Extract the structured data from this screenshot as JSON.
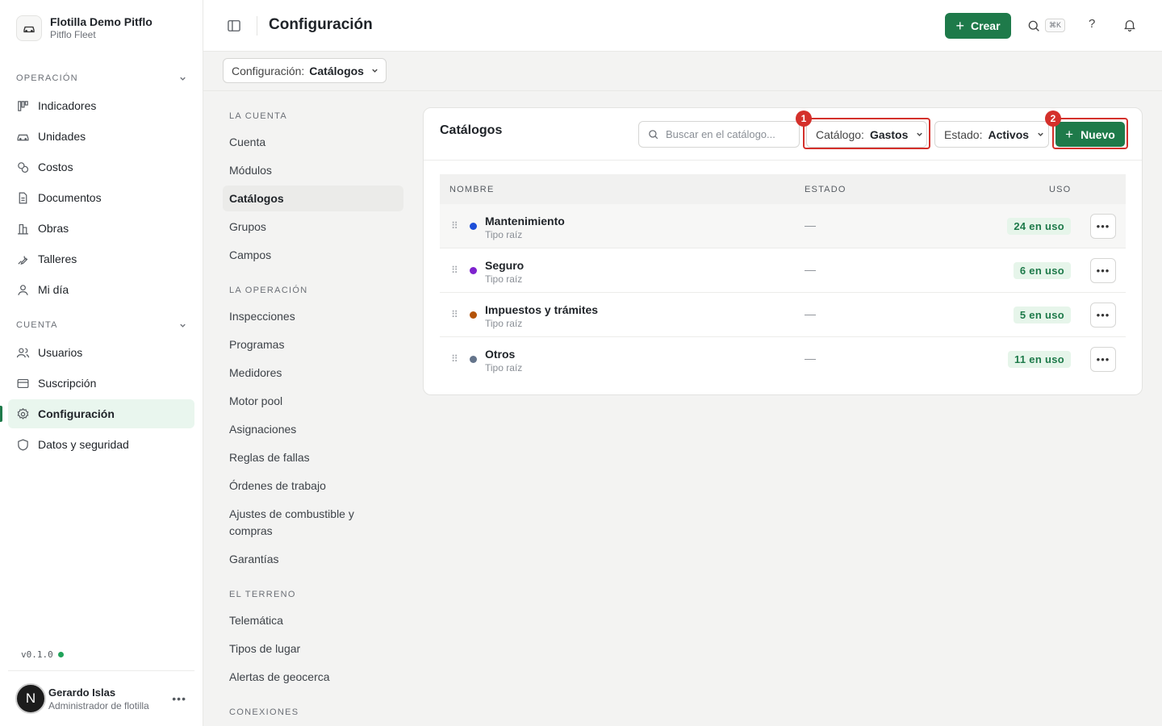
{
  "org": {
    "name": "Flotilla Demo Pitflo",
    "subtitle": "Pitflo Fleet"
  },
  "sidebar": {
    "sections": [
      {
        "title": "OPERACIÓN",
        "items": [
          "Indicadores",
          "Unidades",
          "Costos",
          "Documentos",
          "Obras",
          "Talleres",
          "Mi día"
        ]
      },
      {
        "title": "CUENTA",
        "items": [
          "Usuarios",
          "Suscripción",
          "Configuración",
          "Datos y seguridad"
        ]
      }
    ],
    "active_item": "Configuración",
    "version": "v0.1.0"
  },
  "user": {
    "initial": "N",
    "name": "Gerardo Islas",
    "role": "Administrador de flotilla"
  },
  "topbar": {
    "title": "Configuración",
    "create_label": "Crear",
    "shortcut": "⌘K",
    "help": "?"
  },
  "scope": {
    "label": "Configuración:",
    "value": "Catálogos"
  },
  "settings_nav": {
    "sections": [
      {
        "title": "LA CUENTA",
        "items": [
          "Cuenta",
          "Módulos",
          "Catálogos",
          "Grupos",
          "Campos"
        ]
      },
      {
        "title": "LA OPERACIÓN",
        "items": [
          "Inspecciones",
          "Programas",
          "Medidores",
          "Motor pool",
          "Asignaciones",
          "Reglas de fallas",
          "Órdenes de trabajo",
          "Ajustes de combustible y compras",
          "Garantías"
        ]
      },
      {
        "title": "EL TERRENO",
        "items": [
          "Telemática",
          "Tipos de lugar",
          "Alertas de geocerca"
        ]
      },
      {
        "title": "CONEXIONES",
        "items": []
      }
    ],
    "active_item": "Catálogos"
  },
  "catalog": {
    "title": "Catálogos",
    "search_placeholder": "Buscar en el catálogo...",
    "filter_catalog": {
      "label": "Catálogo:",
      "value": "Gastos"
    },
    "filter_estado": {
      "label": "Estado:",
      "value": "Activos"
    },
    "new_label": "Nuevo",
    "annotations": [
      "1",
      "2"
    ],
    "columns": [
      "NOMBRE",
      "ESTADO",
      "USO"
    ],
    "rows": [
      {
        "name": "Mantenimiento",
        "sub": "Tipo raíz",
        "estado": "—",
        "uso": "24 en uso",
        "color": "#1d4ed8"
      },
      {
        "name": "Seguro",
        "sub": "Tipo raíz",
        "estado": "—",
        "uso": "6 en uso",
        "color": "#7e22ce"
      },
      {
        "name": "Impuestos y trámites",
        "sub": "Tipo raíz",
        "estado": "—",
        "uso": "5 en uso",
        "color": "#b45309"
      },
      {
        "name": "Otros",
        "sub": "Tipo raíz",
        "estado": "—",
        "uso": "11 en uso",
        "color": "#64748b"
      }
    ]
  },
  "colors": {
    "accent": "#1e7a4a",
    "highlight": "#d4302b",
    "active_bg": "#e9f6ee"
  }
}
